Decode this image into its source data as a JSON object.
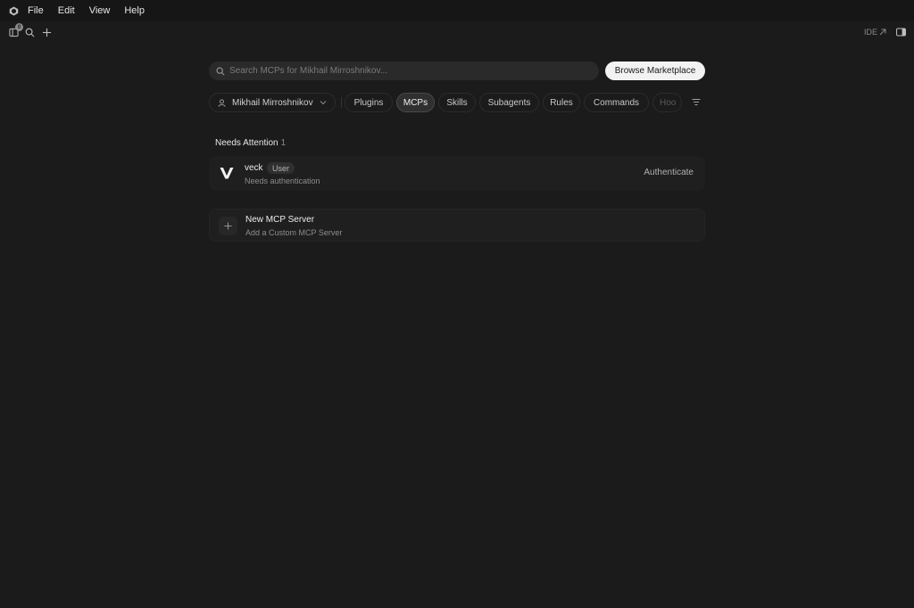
{
  "menu": {
    "items": [
      "File",
      "Edit",
      "View",
      "Help"
    ]
  },
  "toolbar": {
    "agents_badge": "0",
    "ide_label": "IDE"
  },
  "search": {
    "placeholder": "Search MCPs for Mikhail Mirroshnikov...",
    "value": ""
  },
  "browse_button": "Browse Marketplace",
  "scope": {
    "user_name": "Mikhail Mirroshnikov"
  },
  "tabs": [
    {
      "label": "Plugins"
    },
    {
      "label": "MCPs",
      "active": true
    },
    {
      "label": "Skills"
    },
    {
      "label": "Subagents"
    },
    {
      "label": "Rules"
    },
    {
      "label": "Commands"
    },
    {
      "label": "Hoo"
    }
  ],
  "needs_attention": {
    "title": "Needs Attention",
    "count": "1",
    "server": {
      "name": "veck",
      "badge": "User",
      "status": "Needs authentication",
      "action": "Authenticate"
    }
  },
  "new_server": {
    "title": "New MCP Server",
    "subtitle": "Add a Custom MCP Server"
  },
  "colors": {
    "background": "#1b1b1b",
    "card": "#1f1f1f",
    "accent_button": "#f2f2f2"
  }
}
